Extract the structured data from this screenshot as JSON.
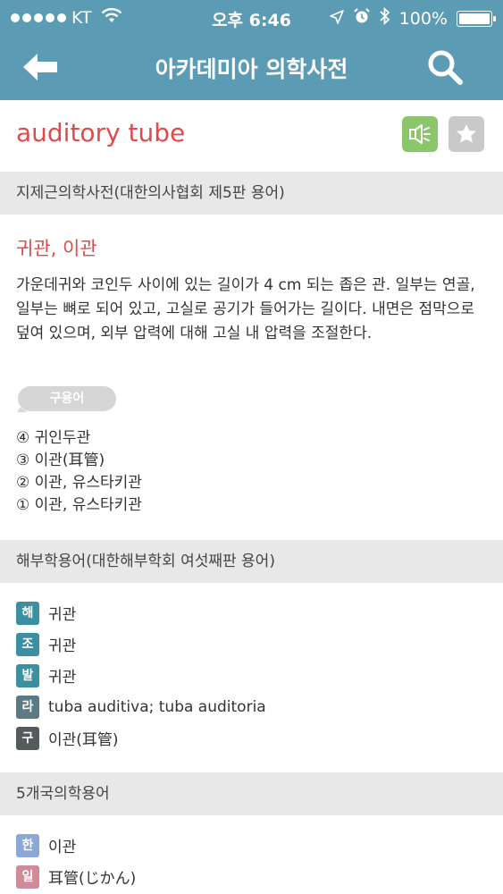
{
  "status_bar": {
    "carrier": "KT",
    "time": "오후 6:46",
    "battery": "100%",
    "battery_level": 1.0,
    "signal_bars_filled": 5,
    "icons": [
      "wifi-icon",
      "location-icon",
      "alarm-icon",
      "bluetooth-icon",
      "battery-icon"
    ]
  },
  "nav": {
    "title": "아카데미아 의학사전",
    "back_icon": "back-arrow-icon",
    "search_icon": "search-icon"
  },
  "entry": {
    "term": "auditory tube",
    "speaker_icon": "speaker-icon",
    "star_icon": "star-icon"
  },
  "sections": {
    "jijegeun": {
      "header": "지제근의학사전(대한의사협회 제5판 용어)",
      "sub_term": "귀관, 이관",
      "definition": "가운데귀와 코인두 사이에 있는 길이가 4 cm 되는 좁은 관. 일부는 연골, 일부는 뼈로 되어 있고, 고실로 공기가 들어가는 길이다. 내면은 점막으로 덮여 있으며, 외부 압력에 대해 고실 내 압력을 조절한다.",
      "old_terms_label": "구용어",
      "old_terms": [
        "④ 귀인두관",
        "③ 이관(耳管)",
        "② 이관, 유스타키관",
        "① 이관, 유스타키관"
      ]
    },
    "anatomy": {
      "header": "해부학용어(대한해부학회 여섯째판 용어)",
      "items": [
        {
          "tag": "해",
          "text": "귀관",
          "color": "#3a8fa0"
        },
        {
          "tag": "조",
          "text": "귀관",
          "color": "#3a8fa0"
        },
        {
          "tag": "발",
          "text": "귀관",
          "color": "#3a8fa0"
        },
        {
          "tag": "라",
          "text": "tuba auditiva; tuba auditoria",
          "color": "#5b7a85"
        },
        {
          "tag": "구",
          "text": "이관(耳管)",
          "color": "#555a5c"
        }
      ]
    },
    "five_country": {
      "header": "5개국의학용어",
      "items": [
        {
          "tag": "한",
          "text": "이관",
          "color": "#8aa8d8"
        },
        {
          "tag": "일",
          "text": "耳管(じかん)",
          "color": "#d08a98"
        }
      ]
    }
  }
}
